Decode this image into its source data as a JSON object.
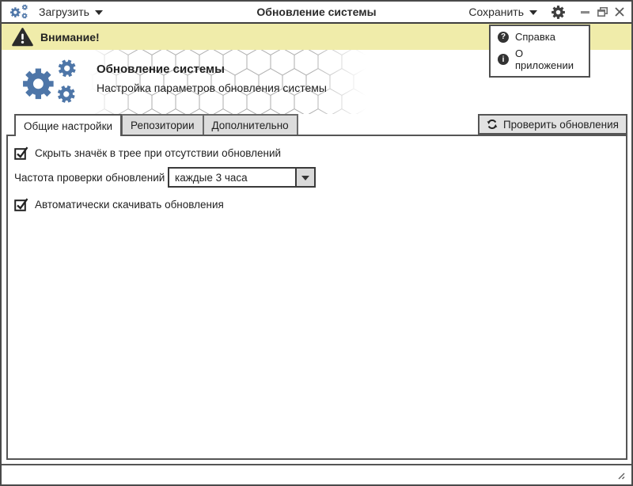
{
  "titlebar": {
    "load_button": "Загрузить",
    "title": "Обновление системы",
    "save_button": "Сохранить"
  },
  "warning_bar": {
    "text": "Внимание!"
  },
  "menu": {
    "items": [
      {
        "icon_glyph": "?",
        "label": "Справка"
      },
      {
        "icon_glyph": "i",
        "label": "О приложении"
      }
    ]
  },
  "header": {
    "title": "Обновление системы",
    "subtitle": "Настройка параметров обновления системы"
  },
  "tabs": [
    {
      "label": "Общие настройки",
      "active": true
    },
    {
      "label": "Репозитории",
      "active": false
    },
    {
      "label": "Дополнительно",
      "active": false
    }
  ],
  "check_updates_button": {
    "label": "Проверить обновления"
  },
  "settings": {
    "hide_tray_icon": {
      "label": "Скрыть значёк в трее при отсутствии обновлений",
      "checked": true
    },
    "frequency": {
      "label": "Частота проверки обновлений",
      "value": "каждые 3 часа"
    },
    "auto_download": {
      "label": "Автоматически скачивать обновления",
      "checked": true
    }
  },
  "colors": {
    "accent_blue": "#4e76a8",
    "warning_yellow": "#f0ecaa",
    "border_dark": "#4a4a4a"
  }
}
